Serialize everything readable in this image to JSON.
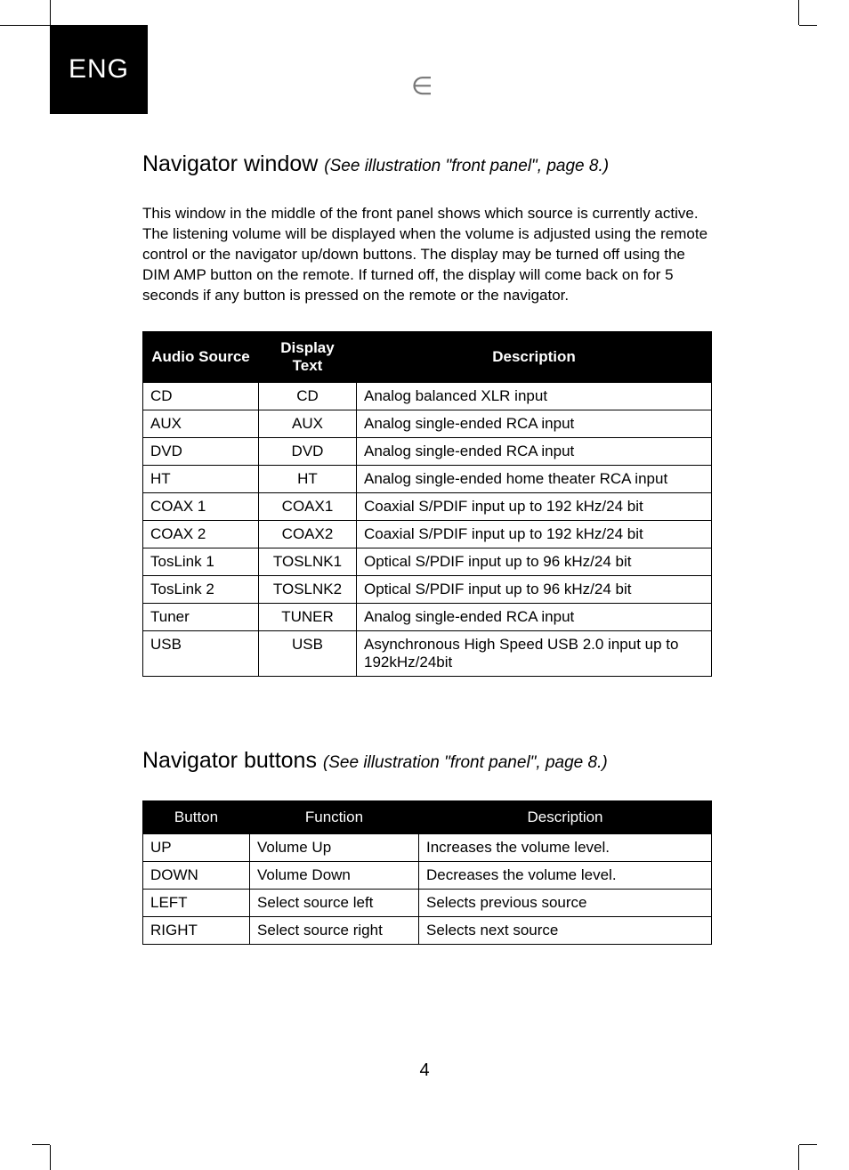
{
  "lang_badge": "ENG",
  "ce_mark": "∈",
  "section1": {
    "title": "Navigator window",
    "ref": "(See illustration \"front panel\", page 8.)",
    "paragraph": "This window in the middle of the front panel shows which source is currently active. The listening volume will be displayed when the volume is adjusted using the remote control or the navigator up/down buttons. The display may be turned off using the DIM AMP button on the remote. If turned off, the display will come back on for 5 seconds if any button is pressed on the remote or the navigator.",
    "table": {
      "headers": [
        "Audio Source",
        "Display Text",
        "Description"
      ],
      "rows": [
        [
          "CD",
          "CD",
          "Analog balanced XLR input"
        ],
        [
          "AUX",
          "AUX",
          "Analog single-ended RCA input"
        ],
        [
          "DVD",
          "DVD",
          "Analog single-ended RCA input"
        ],
        [
          "HT",
          "HT",
          "Analog single-ended home theater RCA input"
        ],
        [
          "COAX 1",
          "COAX1",
          "Coaxial S/PDIF input up to 192 kHz/24 bit"
        ],
        [
          "COAX 2",
          "COAX2",
          "Coaxial S/PDIF input up to 192 kHz/24 bit"
        ],
        [
          "TosLink 1",
          "TOSLNK1",
          "Optical S/PDIF input up to 96 kHz/24 bit"
        ],
        [
          "TosLink 2",
          "TOSLNK2",
          "Optical S/PDIF input up to 96 kHz/24 bit"
        ],
        [
          "Tuner",
          "TUNER",
          "Analog single-ended RCA input"
        ],
        [
          "USB",
          "USB",
          "Asynchronous High Speed USB 2.0 input up to 192kHz/24bit"
        ]
      ]
    }
  },
  "section2": {
    "title": "Navigator buttons",
    "ref": "(See illustration \"front panel\", page 8.)",
    "table": {
      "headers": [
        "Button",
        "Function",
        "Description"
      ],
      "rows": [
        [
          "UP",
          "Volume Up",
          "Increases the volume level."
        ],
        [
          "DOWN",
          "Volume Down",
          "Decreases the volume level."
        ],
        [
          "LEFT",
          "Select source left",
          "Selects previous source"
        ],
        [
          "RIGHT",
          "Select source right",
          "Selects next source"
        ]
      ]
    }
  },
  "page_number": "4"
}
